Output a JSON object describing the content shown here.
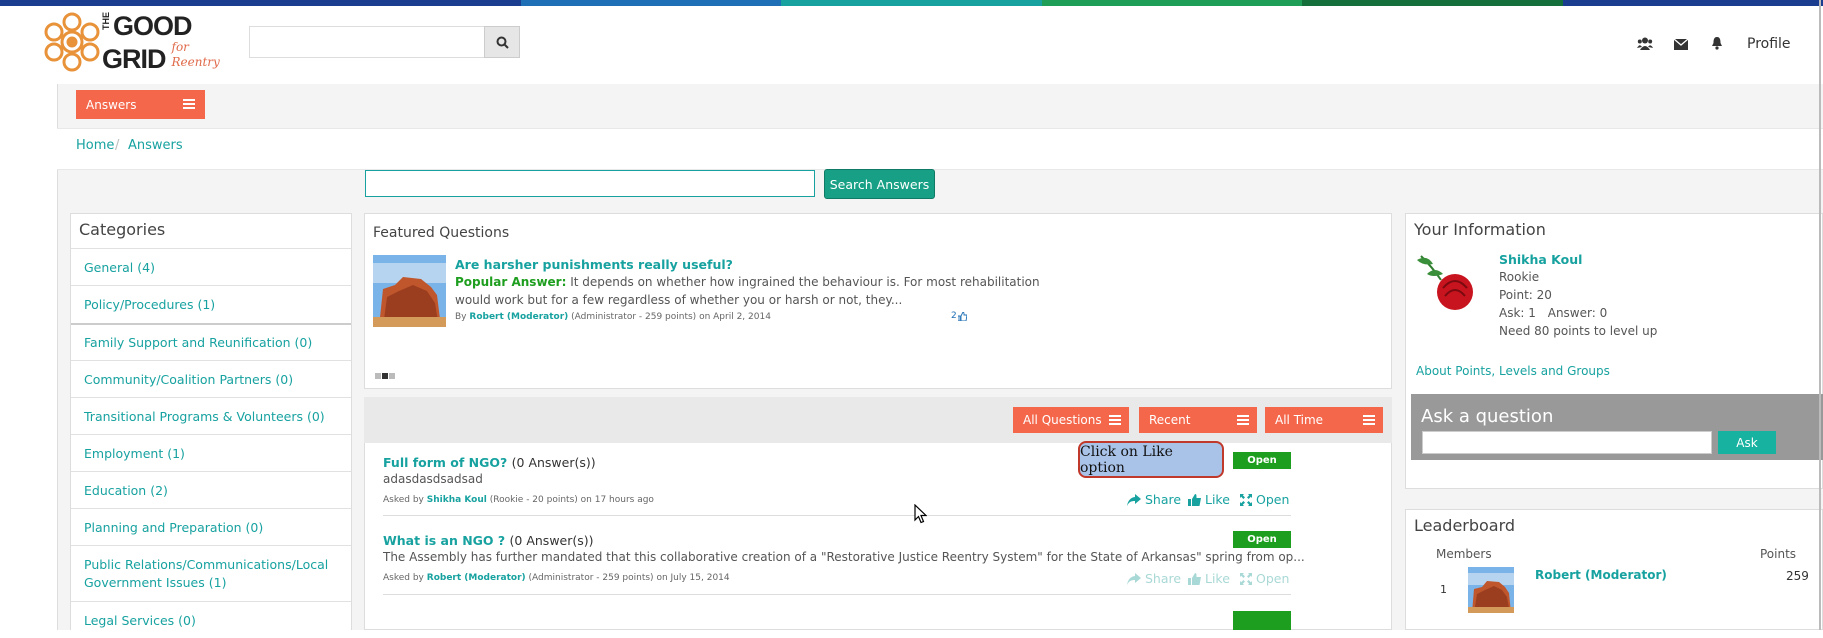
{
  "logo": {
    "line1": "THE",
    "line2": "GOOD",
    "line3": "GRID",
    "tag": "for Reentry"
  },
  "header": {
    "search_placeholder": "",
    "profile_label": "Profile"
  },
  "nav": {
    "answers_label": "Answers"
  },
  "breadcrumb": {
    "home": "Home",
    "sep": "/",
    "current": "Answers"
  },
  "answer_search": {
    "value": "",
    "button_label": "Search Answers"
  },
  "categories": {
    "title": "Categories",
    "items": [
      "General (4)",
      "Policy/Procedures (1)",
      "Family Support and Reunification (0)",
      "Community/Coalition Partners (0)",
      "Transitional Programs & Volunteers (0)",
      "Employment (1)",
      "Education (2)",
      "Planning and Preparation (0)",
      "Public Relations/Communications/Local",
      "Government Issues (1)",
      "Legal Services (0)"
    ]
  },
  "featured": {
    "title": "Featured Questions",
    "question": "Are harsher punishments really useful?",
    "popular_label": "Popular Answer:",
    "answer_line1": "It depends on whether how ingrained the behaviour is. For most rehabilitation",
    "answer_line2": "would work but for a few regardless of whether you or harsh or not, they...",
    "by": "By",
    "author": "Robert (Moderator)",
    "author_meta": "(Administrator - 259 points)",
    "date": "on April 2, 2014",
    "likes": "2"
  },
  "filters": {
    "all_questions": "All Questions",
    "recent": "Recent",
    "all_time": "All Time"
  },
  "questions": [
    {
      "title": "Full form of NGO?",
      "count": "(0 Answer(s))",
      "body": "adasdasdsadsad",
      "asked_by": "Asked by",
      "author": "Shikha Koul",
      "meta": "(Rookie - 20 points)",
      "when": "on 17 hours ago",
      "status": "Open",
      "share": "Share",
      "like": "Like",
      "open": "Open"
    },
    {
      "title": "What is an NGO ?",
      "count": "(0 Answer(s))",
      "body": "The Assembly has further mandated that this collaborative creation of a \"Restorative Justice Reentry System\" for the State of Arkansas\" spring from op...",
      "asked_by": "Asked by",
      "author": "Robert (Moderator)",
      "meta": "(Administrator - 259 points)",
      "when": "on July 15, 2014",
      "status": "Open",
      "share": "Share",
      "like": "Like",
      "open": "Open"
    }
  ],
  "callout": {
    "text": "Click on Like option"
  },
  "your_info": {
    "title": "Your Information",
    "name": "Shikha Koul",
    "rank": "Rookie",
    "points": "Point: 20",
    "ask": "Ask: 1",
    "answer": "Answer: 0",
    "need": "Need 80 points to level up",
    "about_link": "About Points, Levels and Groups"
  },
  "ask_question": {
    "title": "Ask a question",
    "button_label": "Ask"
  },
  "leaderboard": {
    "title": "Leaderboard",
    "members_label": "Members",
    "points_label": "Points",
    "rows": [
      {
        "rank": "1",
        "name": "Robert (Moderator)",
        "points": "259"
      }
    ]
  },
  "colors": {
    "accent": "#f4674b",
    "teal": "#17a2a0",
    "open_green": "#1e9e1e"
  },
  "icons": [
    "search-icon",
    "group-icon",
    "envelope-icon",
    "bell-icon",
    "hamburger-icon",
    "share-icon",
    "thumbs-up-icon",
    "expand-icon"
  ]
}
